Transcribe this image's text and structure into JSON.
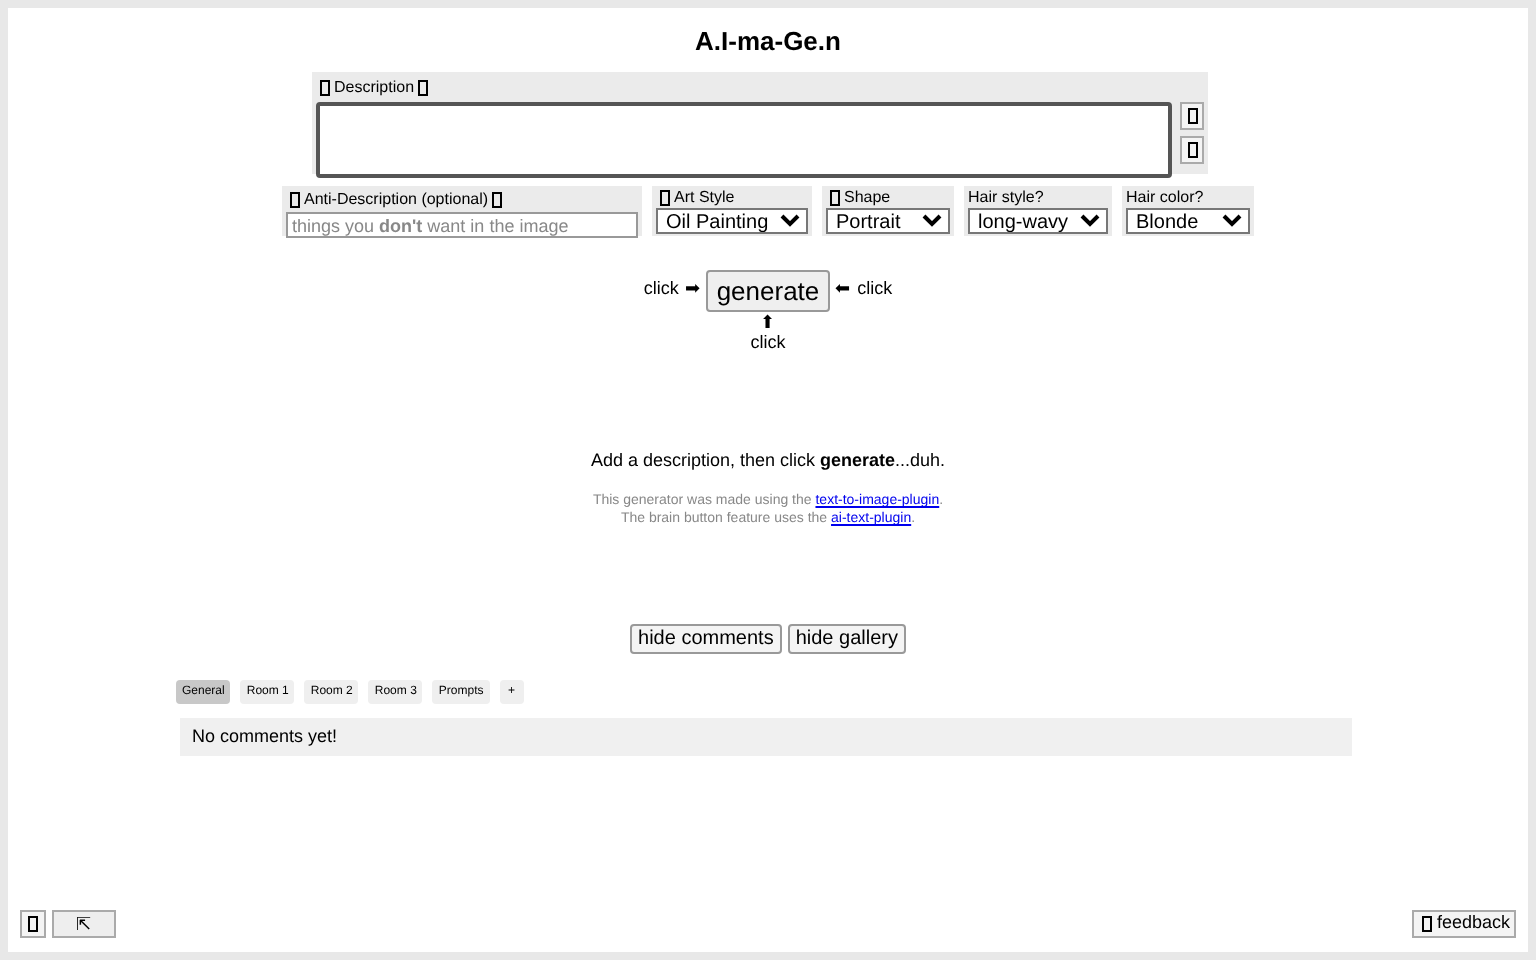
{
  "title": "A.I-ma-Ge.n",
  "description": {
    "label": "Description"
  },
  "anti_description": {
    "label": "Anti-Description (optional)",
    "placeholder": "things you **don't** want in the image"
  },
  "selects": [
    {
      "label": "Art Style",
      "icon": true,
      "value": "Oil Painting"
    },
    {
      "label": "Shape",
      "icon": true,
      "value": "Portrait"
    },
    {
      "label": "Hair style?",
      "icon": false,
      "value": "long-wavy"
    },
    {
      "label": "Hair color?",
      "icon": false,
      "value": "Blonde"
    }
  ],
  "generate": {
    "label": "generate",
    "left_hint": "click",
    "left_arrow": "➡",
    "right_arrow": "⬅",
    "right_hint": "click",
    "bottom_arrow": "⬆",
    "bottom_hint": "click"
  },
  "message": "Add a description, then click **generate**...duh.",
  "credits": [
    {
      "text": "This generator was made using the",
      "link": "text-to-image-plugin",
      "end": "."
    },
    {
      "text": "The brain button feature uses the",
      "link": "ai-text-plugin",
      "end": "."
    }
  ],
  "toggle_buttons": [
    "hide comments",
    "hide gallery"
  ],
  "comment_tabs": [
    {
      "label": "General",
      "selected": true
    },
    {
      "label": "Room 1",
      "selected": false
    },
    {
      "label": "Room 2",
      "selected": false
    },
    {
      "label": "Room 3",
      "selected": false
    },
    {
      "label": "Prompts",
      "selected": false
    },
    {
      "label": "+",
      "selected": false
    }
  ],
  "comments_message": "No comments yet!",
  "footer": {
    "expand_label": "⇱",
    "feedback_label": "feedback"
  }
}
